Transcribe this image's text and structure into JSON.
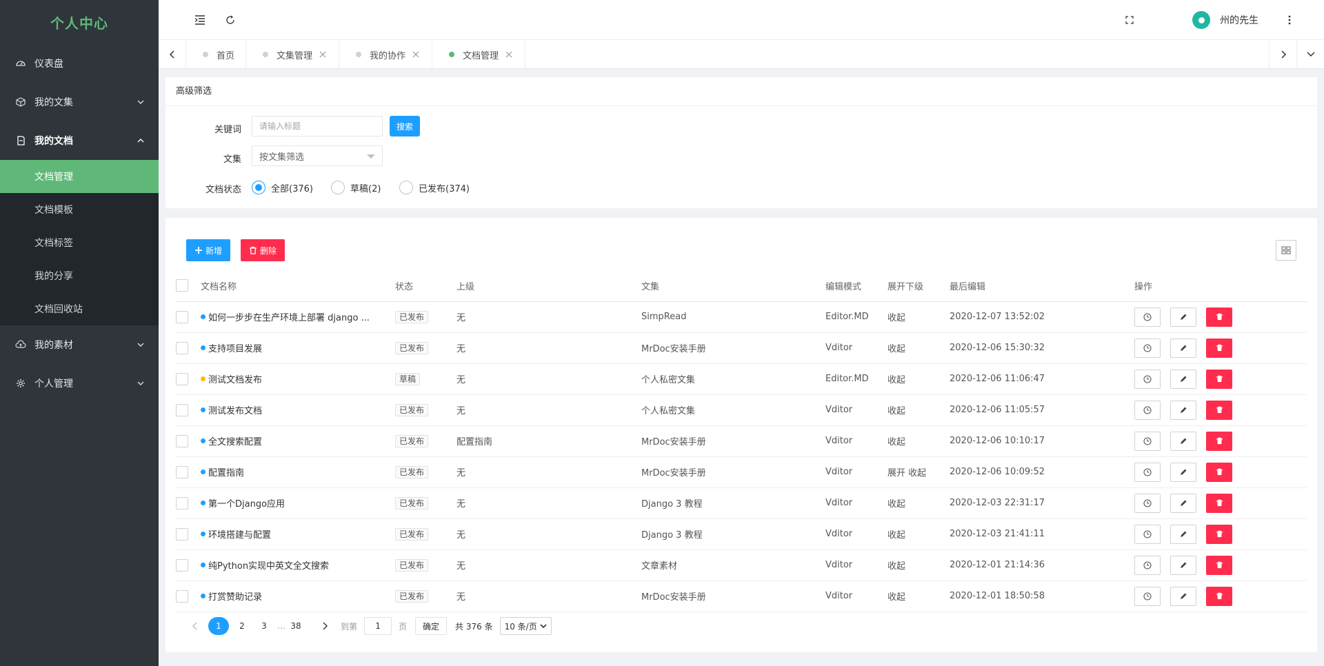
{
  "brand": "个人中心",
  "sidebar": {
    "items": [
      {
        "label": "仪表盘",
        "icon": "dashboard-icon"
      },
      {
        "label": "我的文集",
        "icon": "cube-icon"
      },
      {
        "label": "我的文档",
        "icon": "document-icon"
      },
      {
        "label": "我的素材",
        "icon": "cloud-icon"
      },
      {
        "label": "个人管理",
        "icon": "gear-icon"
      }
    ],
    "submenu": [
      {
        "label": "文档管理"
      },
      {
        "label": "文档模板"
      },
      {
        "label": "文档标签"
      },
      {
        "label": "我的分享"
      },
      {
        "label": "文档回收站"
      }
    ]
  },
  "header": {
    "username": "州的先生"
  },
  "tabs": [
    {
      "label": "首页"
    },
    {
      "label": "文集管理"
    },
    {
      "label": "我的协作"
    },
    {
      "label": "文档管理"
    }
  ],
  "filter": {
    "title": "高级筛选",
    "keyword_label": "关键词",
    "keyword_placeholder": "请输入标题",
    "search_button": "搜索",
    "collection_label": "文集",
    "collection_placeholder": "按文集筛选",
    "status_label": "文档状态",
    "status_options": [
      "全部(376)",
      "草稿(2)",
      "已发布(374)"
    ]
  },
  "toolbar": {
    "add": "新增",
    "delete": "删除"
  },
  "table": {
    "columns": [
      "文档名称",
      "状态",
      "上级",
      "文集",
      "编辑模式",
      "展开下级",
      "最后编辑",
      "操作"
    ],
    "rows": [
      {
        "name": "如何一步步在生产环境上部署 django ...",
        "status": "已发布",
        "parent": "无",
        "collection": "SimpRead",
        "mode": "Editor.MD",
        "expand": "收起",
        "edited": "2020-12-07 13:52:02"
      },
      {
        "name": "支持项目发展",
        "status": "已发布",
        "parent": "无",
        "collection": "MrDoc安装手册",
        "mode": "Vditor",
        "expand": "收起",
        "edited": "2020-12-06 15:30:32"
      },
      {
        "name": "测试文档发布",
        "status": "草稿",
        "parent": "无",
        "collection": "个人私密文集",
        "mode": "Editor.MD",
        "expand": "收起",
        "edited": "2020-12-06 11:06:47"
      },
      {
        "name": "测试发布文档",
        "status": "已发布",
        "parent": "无",
        "collection": "个人私密文集",
        "mode": "Vditor",
        "expand": "收起",
        "edited": "2020-12-06 11:05:57"
      },
      {
        "name": "全文搜索配置",
        "status": "已发布",
        "parent": "配置指南",
        "collection": "MrDoc安装手册",
        "mode": "Vditor",
        "expand": "收起",
        "edited": "2020-12-06 10:10:17"
      },
      {
        "name": "配置指南",
        "status": "已发布",
        "parent": "无",
        "collection": "MrDoc安装手册",
        "mode": "Vditor",
        "expand": "展开 收起",
        "edited": "2020-12-06 10:09:52"
      },
      {
        "name": "第一个Django应用",
        "status": "已发布",
        "parent": "无",
        "collection": "Django 3 教程",
        "mode": "Vditor",
        "expand": "收起",
        "edited": "2020-12-03 22:31:17"
      },
      {
        "name": "环境搭建与配置",
        "status": "已发布",
        "parent": "无",
        "collection": "Django 3 教程",
        "mode": "Vditor",
        "expand": "收起",
        "edited": "2020-12-03 21:41:11"
      },
      {
        "name": "纯Python实现中英文全文搜索",
        "status": "已发布",
        "parent": "无",
        "collection": "文章素材",
        "mode": "Vditor",
        "expand": "收起",
        "edited": "2020-12-01 21:14:36"
      },
      {
        "name": "打赏赞助记录",
        "status": "已发布",
        "parent": "无",
        "collection": "MrDoc安装手册",
        "mode": "Vditor",
        "expand": "收起",
        "edited": "2020-12-01 18:50:58"
      }
    ]
  },
  "pagination": {
    "pages": [
      "1",
      "2",
      "3"
    ],
    "ellipsis": "…",
    "last": "38",
    "goto_label": "到第",
    "goto_value": "1",
    "page_unit": "页",
    "confirm": "确定",
    "total": "共 376 条",
    "page_size": "10 条/页"
  },
  "colors": {
    "brand_green": "#5fb878",
    "primary_blue": "#1e9fff",
    "danger_red": "#ff2c4d",
    "draft_orange": "#ffb800",
    "sidebar_bg": "#2f353b"
  }
}
